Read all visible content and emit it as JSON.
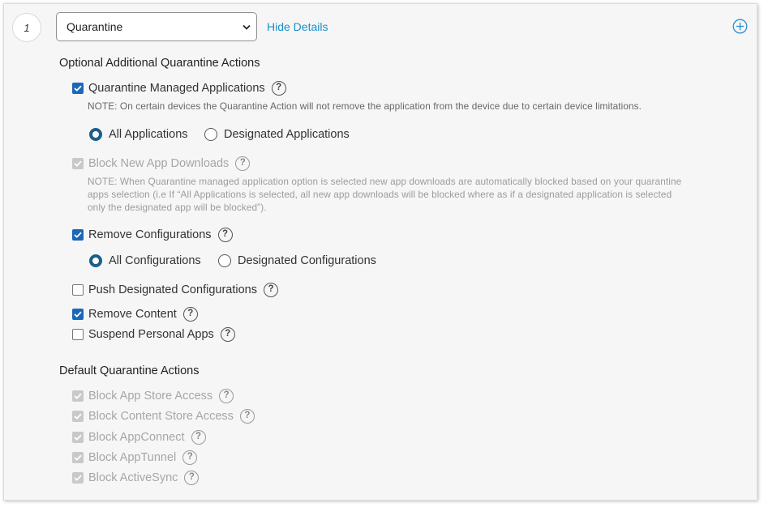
{
  "step": {
    "number": "1"
  },
  "action_select": {
    "value": "Quarantine"
  },
  "details_link": "Hide Details",
  "optional": {
    "heading": "Optional Additional Quarantine Actions",
    "quarantine_managed_apps": {
      "label": "Quarantine Managed Applications",
      "checked": true,
      "note": "NOTE: On certain devices the Quarantine Action will not remove the application from the device due to certain device limitations.",
      "options": [
        "All Applications",
        "Designated Applications"
      ],
      "selected": "All Applications"
    },
    "block_new_app_downloads": {
      "label": "Block New App Downloads",
      "checked": true,
      "disabled": true,
      "note_lines": [
        "NOTE: When Quarantine managed application option is selected new app downloads are automatically blocked based on your quarantine",
        "apps selection (i.e If “All Applications is selected, all new app downloads will be blocked where as if a designated application is selected",
        "only the designated app will be blocked”)."
      ]
    },
    "remove_configurations": {
      "label": "Remove Configurations",
      "checked": true,
      "options": [
        "All Configurations",
        "Designated Configurations"
      ],
      "selected": "All Configurations"
    },
    "push_designated_configurations": {
      "label": "Push Designated Configurations",
      "checked": false
    },
    "remove_content": {
      "label": "Remove Content",
      "checked": true
    },
    "suspend_personal_apps": {
      "label": "Suspend Personal Apps",
      "checked": false
    }
  },
  "default": {
    "heading": "Default Quarantine Actions",
    "items": [
      {
        "label": "Block App Store Access",
        "checked": true,
        "disabled": true
      },
      {
        "label": "Block Content Store Access",
        "checked": true,
        "disabled": true
      },
      {
        "label": "Block AppConnect",
        "checked": true,
        "disabled": true
      },
      {
        "label": "Block AppTunnel",
        "checked": true,
        "disabled": true
      },
      {
        "label": "Block ActiveSync",
        "checked": true,
        "disabled": true
      }
    ]
  },
  "help_glyph": "?",
  "icons": {
    "add": "plus-circle-icon",
    "dropdown": "chevron-down-icon",
    "help": "question-circle-icon"
  },
  "colors": {
    "accent_link": "#1a8fc9",
    "checkbox_checked": "#1d68b6",
    "radio_selected": "#1d5f8a",
    "disabled_text": "#a6a6a6"
  }
}
